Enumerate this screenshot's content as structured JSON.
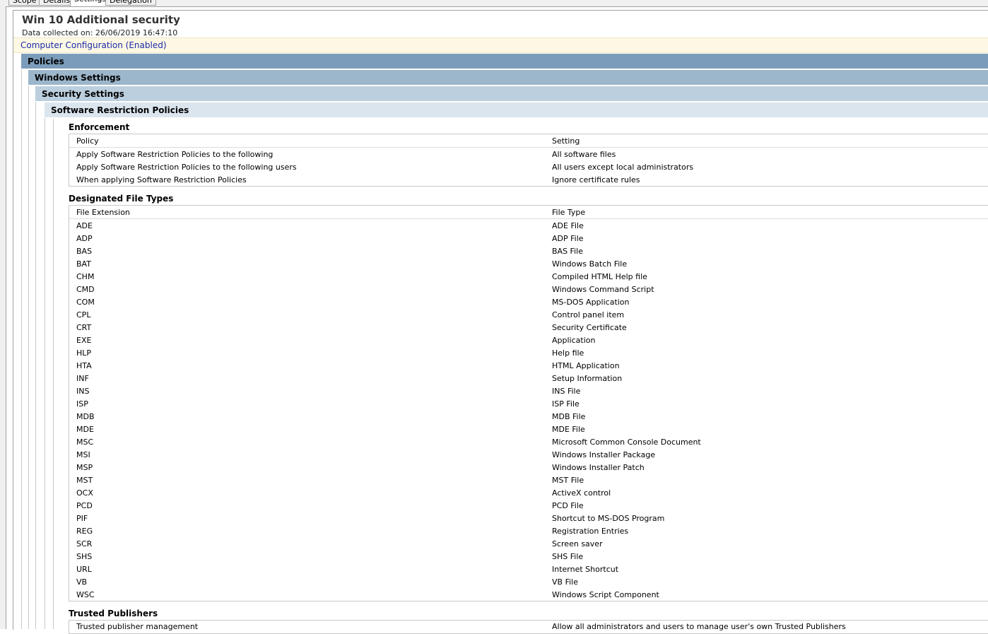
{
  "tabs": [
    {
      "label": "Scope"
    },
    {
      "label": "Details"
    },
    {
      "label": "Settings"
    },
    {
      "label": "Delegation"
    }
  ],
  "report": {
    "title": "Win 10 Additional security",
    "collected": "Data collected on: 26/06/2019 16:47:10",
    "section": "Computer Configuration (Enabled)"
  },
  "headers": {
    "policies": "Policies",
    "windows_settings": "Windows Settings",
    "security_settings": "Security Settings",
    "srp": "Software Restriction Policies"
  },
  "enforcement": {
    "title": "Enforcement",
    "columns": [
      "Policy",
      "Setting"
    ],
    "rows": [
      [
        "Apply Software Restriction Policies to the following",
        "All software files"
      ],
      [
        "Apply Software Restriction Policies to the following users",
        "All users except local administrators"
      ],
      [
        "When applying Software Restriction Policies",
        "Ignore certificate rules"
      ]
    ]
  },
  "file_types": {
    "title": "Designated File Types",
    "columns": [
      "File Extension",
      "File Type"
    ],
    "rows": [
      [
        "ADE",
        "ADE File"
      ],
      [
        "ADP",
        "ADP File"
      ],
      [
        "BAS",
        "BAS File"
      ],
      [
        "BAT",
        "Windows Batch File"
      ],
      [
        "CHM",
        "Compiled HTML Help file"
      ],
      [
        "CMD",
        "Windows Command Script"
      ],
      [
        "COM",
        "MS-DOS Application"
      ],
      [
        "CPL",
        "Control panel item"
      ],
      [
        "CRT",
        "Security Certificate"
      ],
      [
        "EXE",
        "Application"
      ],
      [
        "HLP",
        "Help file"
      ],
      [
        "HTA",
        "HTML Application"
      ],
      [
        "INF",
        "Setup Information"
      ],
      [
        "INS",
        "INS File"
      ],
      [
        "ISP",
        "ISP File"
      ],
      [
        "MDB",
        "MDB File"
      ],
      [
        "MDE",
        "MDE File"
      ],
      [
        "MSC",
        "Microsoft Common Console Document"
      ],
      [
        "MSI",
        "Windows Installer Package"
      ],
      [
        "MSP",
        "Windows Installer Patch"
      ],
      [
        "MST",
        "MST File"
      ],
      [
        "OCX",
        "ActiveX control"
      ],
      [
        "PCD",
        "PCD File"
      ],
      [
        "PIF",
        "Shortcut to MS-DOS Program"
      ],
      [
        "REG",
        "Registration Entries"
      ],
      [
        "SCR",
        "Screen saver"
      ],
      [
        "SHS",
        "SHS File"
      ],
      [
        "URL",
        "Internet Shortcut"
      ],
      [
        "VB",
        "VB File"
      ],
      [
        "WSC",
        "Windows Script Component"
      ]
    ]
  },
  "trusted": {
    "title": "Trusted Publishers",
    "rows": [
      [
        "Trusted publisher management",
        "Allow all administrators and users to manage user's own Trusted Publishers"
      ]
    ]
  }
}
